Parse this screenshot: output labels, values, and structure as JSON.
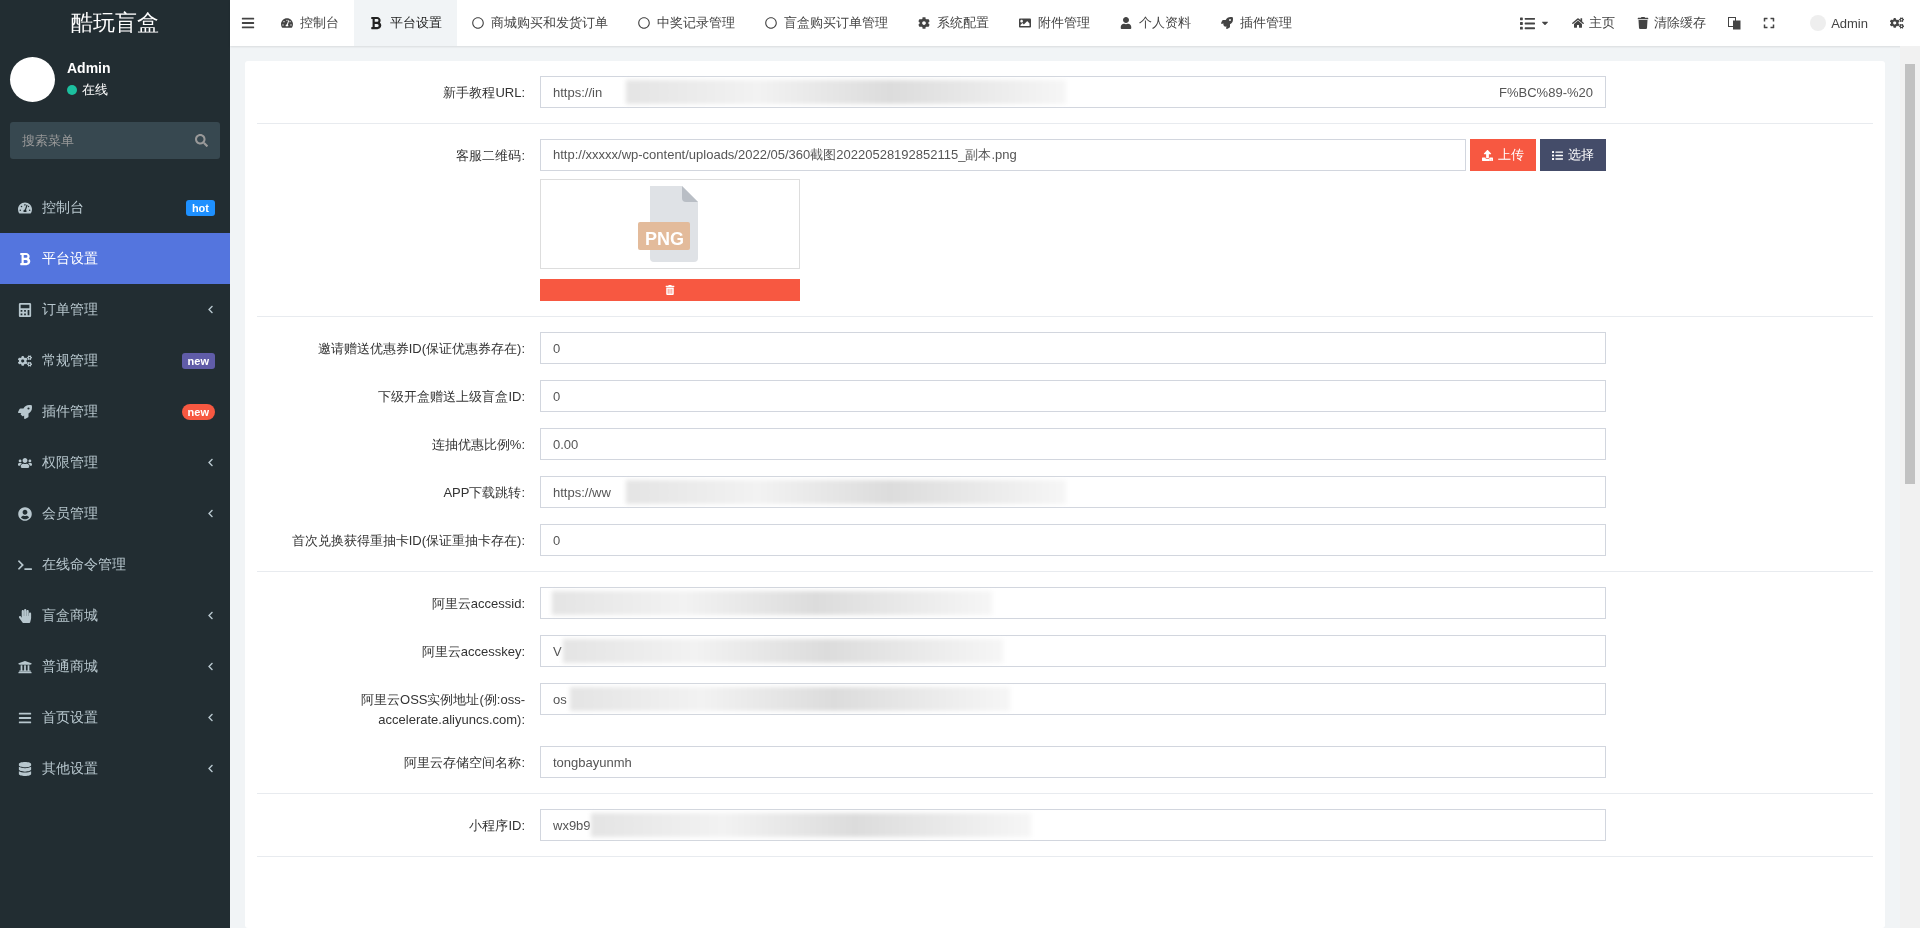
{
  "brand": "酷玩盲盒",
  "user": {
    "name": "Admin",
    "status": "在线",
    "online": true
  },
  "search": {
    "placeholder": "搜索菜单"
  },
  "sidebar": {
    "items": [
      {
        "label": "控制台",
        "selected": false,
        "badge": {
          "text": "hot",
          "color": "#1e90ff"
        }
      },
      {
        "label": "平台设置",
        "selected": true
      },
      {
        "label": "订单管理",
        "selected": false,
        "expandable": true
      },
      {
        "label": "常规管理",
        "selected": false,
        "badge": {
          "text": "new",
          "color": "#605ca8"
        }
      },
      {
        "label": "插件管理",
        "selected": false,
        "badge": {
          "text": "new",
          "color": "#f75841"
        }
      },
      {
        "label": "权限管理",
        "selected": false,
        "expandable": true
      },
      {
        "label": "会员管理",
        "selected": false,
        "expandable": true
      },
      {
        "label": "在线命令管理",
        "selected": false
      },
      {
        "label": "盲盒商城",
        "selected": false,
        "expandable": true
      },
      {
        "label": "普通商城",
        "selected": false,
        "expandable": true
      },
      {
        "label": "首页设置",
        "selected": false,
        "expandable": true
      },
      {
        "label": "其他设置",
        "selected": false,
        "expandable": true
      }
    ]
  },
  "tabs": [
    {
      "label": "控制台",
      "selected": false
    },
    {
      "label": "平台设置",
      "selected": true
    },
    {
      "label": "商城购买和发货订单",
      "selected": false
    },
    {
      "label": "中奖记录管理",
      "selected": false
    },
    {
      "label": "盲盒购买订单管理",
      "selected": false
    },
    {
      "label": "系统配置",
      "selected": false
    },
    {
      "label": "附件管理",
      "selected": false
    },
    {
      "label": "个人资料",
      "selected": false
    },
    {
      "label": "插件管理",
      "selected": false
    }
  ],
  "toolbar": [
    "主页",
    "清除缓存"
  ],
  "top_user": "Admin",
  "sections": [
    [
      {
        "kind": "text",
        "label": "新手教程URL:",
        "value": "https://in",
        "blurred": true,
        "value_end": "F%BC%89-%20"
      }
    ],
    [
      {
        "kind": "upload",
        "label": "客服二维码:",
        "value": "http://xxxxx/wp-content/uploads/2022/05/360截图20220528192852115_副本.png",
        "upload_button": "上传",
        "choose_button": "选择",
        "file_type": "PNG"
      }
    ],
    [
      {
        "kind": "text",
        "label": "邀请赠送优惠券ID(保证优惠券存在):",
        "value": "0"
      },
      {
        "kind": "text",
        "label": "下级开盒赠送上级盲盒ID:",
        "value": "0"
      },
      {
        "kind": "text",
        "label": "连抽优惠比例%:",
        "value": "0.00"
      },
      {
        "kind": "text",
        "label": "APP下载跳转:",
        "value": "https://ww",
        "blurred": true
      },
      {
        "kind": "text",
        "label": "首次兑换获得重抽卡ID(保证重抽卡存在):",
        "value": "0"
      }
    ],
    [
      {
        "kind": "text",
        "label": "阿里云accessid:",
        "blurred": true
      },
      {
        "kind": "text",
        "label": "阿里云accesskey:",
        "value": "V",
        "blurred": true
      },
      {
        "kind": "text",
        "label": "阿里云OSS实例地址(例:oss-accelerate.aliyuncs.com):",
        "value": "os",
        "blurred": true
      },
      {
        "kind": "text",
        "label": "阿里云存储空间名称:",
        "value": "tongbayunmh"
      }
    ],
    [
      {
        "kind": "text",
        "label": "小程序ID:",
        "value": "wx9b9",
        "blurred": true
      }
    ]
  ]
}
